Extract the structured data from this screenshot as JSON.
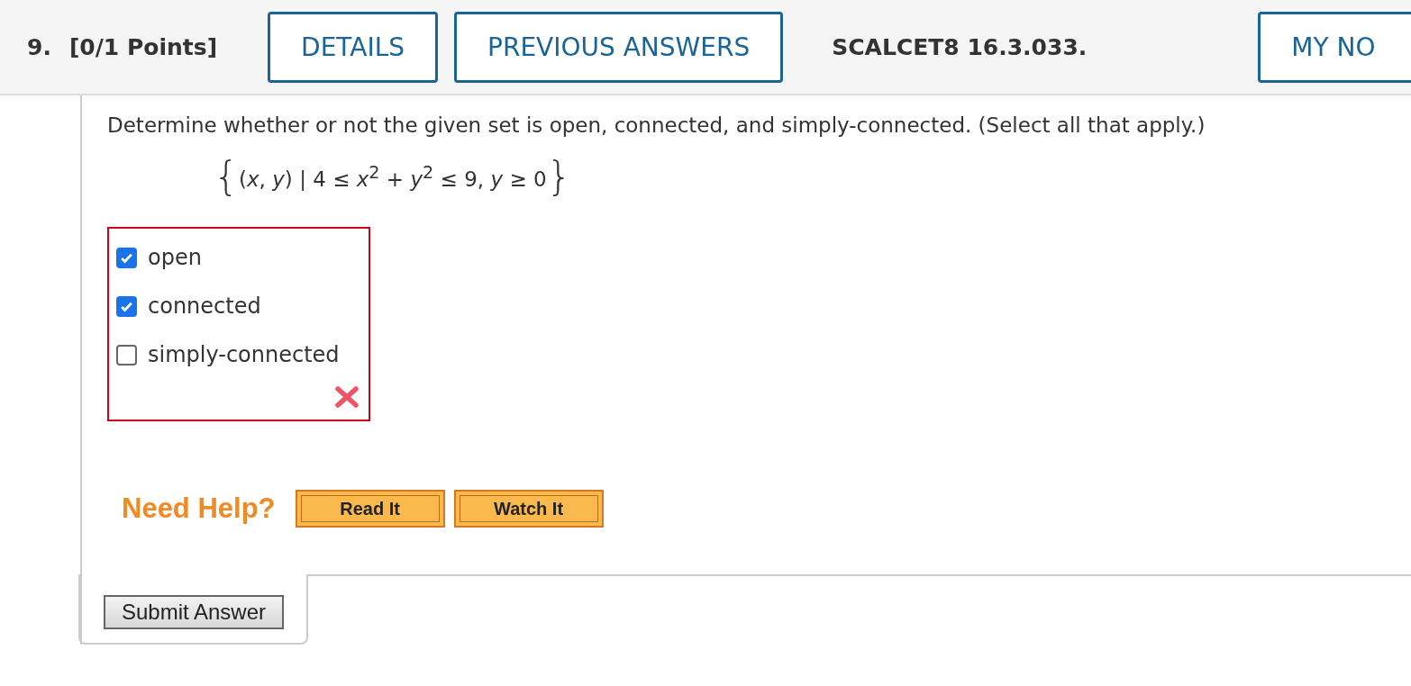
{
  "header": {
    "number": "9.",
    "points": "[0/1 Points]",
    "buttons": [
      "DETAILS",
      "PREVIOUS ANSWERS"
    ],
    "code": "SCALCET8 16.3.033.",
    "cut_button": "MY NO"
  },
  "question": {
    "prompt": "Determine whether or not the given set is open, connected, and simply-connected. (Select all that apply.)",
    "set": {
      "open_brace": "{",
      "expression": "(*x*, *y*) | 4 ≤ *x*$^{2}$ + *y*$^{2}$ ≤ 9, *y* ≥ 0",
      "close_brace": "}"
    }
  },
  "answers": {
    "options": [
      {
        "label": "open",
        "checked": true
      },
      {
        "label": "connected",
        "checked": true
      },
      {
        "label": "simply-connected",
        "checked": false
      }
    ],
    "correct": false
  },
  "help": {
    "label": "Need Help?",
    "buttons": [
      "Read It",
      "Watch It"
    ]
  },
  "submit": "Submit Answer"
}
